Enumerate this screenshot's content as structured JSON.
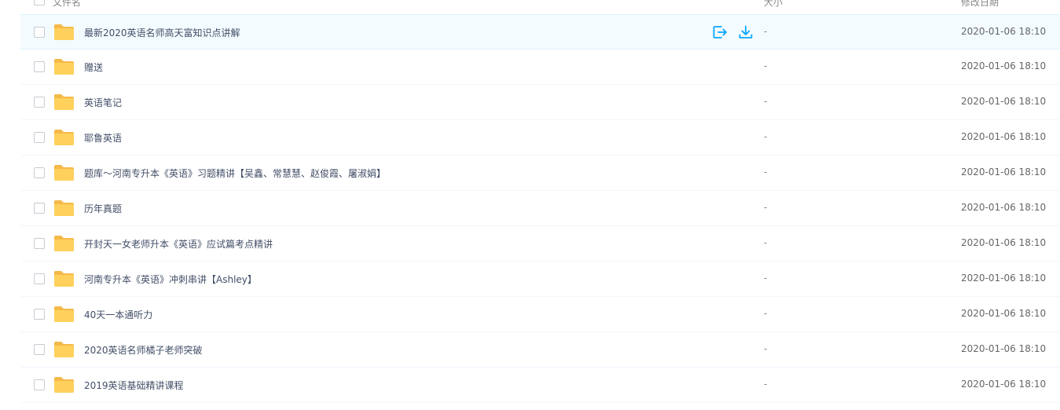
{
  "header": {
    "name_label": "文件名",
    "size_label": "大小",
    "date_label": "修改日期"
  },
  "colors": {
    "folder": "#ffd15c",
    "folder_tab": "#f5b94a",
    "action_blue": "#06a7ff",
    "active_row_bg": "#f4fbff"
  },
  "files": [
    {
      "name": "最新2020英语名师高天富知识点讲解",
      "size": "-",
      "date": "2020-01-06 18:10",
      "icon": "folder-icon"
    },
    {
      "name": "赠送",
      "size": "-",
      "date": "2020-01-06 18:10",
      "icon": "folder-icon"
    },
    {
      "name": "英语笔记",
      "size": "-",
      "date": "2020-01-06 18:10",
      "icon": "folder-icon"
    },
    {
      "name": "耶鲁英语",
      "size": "-",
      "date": "2020-01-06 18:10",
      "icon": "folder-icon"
    },
    {
      "name": "题库～河南专升本《英语》习题精讲【吴鑫、常慧慧、赵俊霞、屠淑娟】",
      "size": "-",
      "date": "2020-01-06 18:10",
      "icon": "folder-icon"
    },
    {
      "name": "历年真题",
      "size": "-",
      "date": "2020-01-06 18:10",
      "icon": "folder-icon"
    },
    {
      "name": "开封天一女老师升本《英语》应试篇考点精讲",
      "size": "-",
      "date": "2020-01-06 18:10",
      "icon": "folder-icon"
    },
    {
      "name": "河南专升本《英语》冲刺串讲【Ashley】",
      "size": "-",
      "date": "2020-01-06 18:10",
      "icon": "folder-icon"
    },
    {
      "name": "40天一本通听力",
      "size": "-",
      "date": "2020-01-06 18:10",
      "icon": "folder-icon"
    },
    {
      "name": "2020英语名师橘子老师突破",
      "size": "-",
      "date": "2020-01-06 18:10",
      "icon": "folder-icon"
    },
    {
      "name": "2019英语基础精讲课程",
      "size": "-",
      "date": "2020-01-06 18:10",
      "icon": "folder-icon"
    }
  ]
}
